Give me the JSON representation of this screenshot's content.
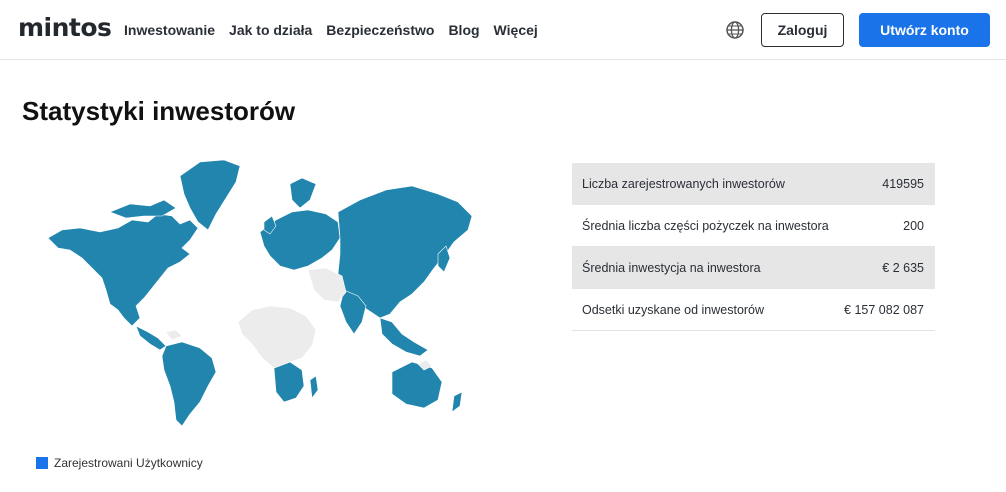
{
  "header": {
    "logo": "mintos",
    "nav": [
      "Inwestowanie",
      "Jak to działa",
      "Bezpieczeństwo",
      "Blog",
      "Więcej"
    ],
    "language_icon": "globe-icon",
    "login_label": "Zaloguj",
    "signup_label": "Utwórz konto"
  },
  "page": {
    "title": "Statystyki inwestorów"
  },
  "map": {
    "filled_color": "#2185ad",
    "empty_color": "#ececec",
    "legend_color": "#1a73e8",
    "legend_label": "Zarejestrowani Użytkownicy"
  },
  "stats": [
    {
      "label": "Liczba zarejestrowanych inwestorów",
      "value": "419595"
    },
    {
      "label": "Średnia liczba części pożyczek na inwestora",
      "value": "200"
    },
    {
      "label": "Średnia inwestycja na inwestora",
      "value": "€ 2 635"
    },
    {
      "label": "Odsetki uzyskane od inwestorów",
      "value": "€ 157 082 087"
    }
  ]
}
